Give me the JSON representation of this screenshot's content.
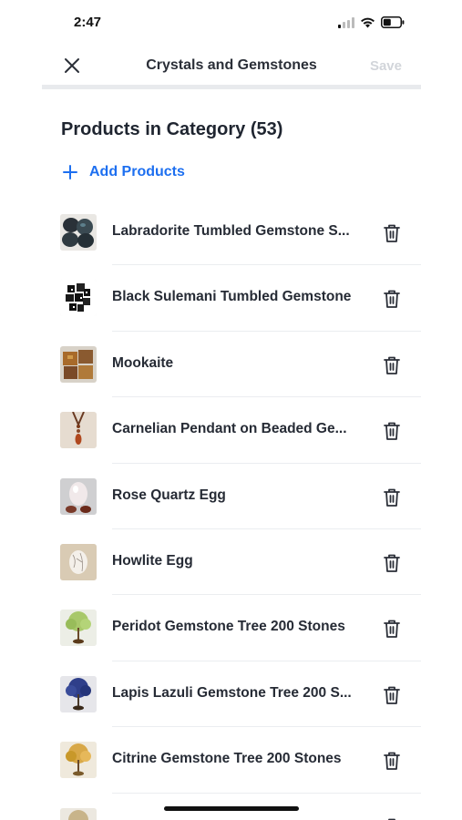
{
  "status_bar": {
    "time": "2:47"
  },
  "header": {
    "title": "Crystals and Gemstones",
    "save_label": "Save"
  },
  "section": {
    "title": "Products in Category (53)",
    "add_label": "Add Products"
  },
  "products": [
    {
      "name": "Labradorite Tumbled Gemstone S...",
      "thumb": "labradorite"
    },
    {
      "name": "Black Sulemani Tumbled Gemstone",
      "thumb": "sulemani"
    },
    {
      "name": "Mookaite",
      "thumb": "mookaite"
    },
    {
      "name": "Carnelian Pendant on Beaded Ge...",
      "thumb": "carnelian"
    },
    {
      "name": "Rose Quartz Egg",
      "thumb": "rose-quartz"
    },
    {
      "name": "Howlite Egg",
      "thumb": "howlite"
    },
    {
      "name": "Peridot Gemstone Tree 200 Stones",
      "thumb": "peridot-tree"
    },
    {
      "name": "Lapis Lazuli Gemstone Tree 200 S...",
      "thumb": "lapis-tree"
    },
    {
      "name": "Citrine Gemstone Tree 200 Stones",
      "thumb": "citrine-tree"
    },
    {
      "name": "",
      "thumb": "partial"
    }
  ],
  "colors": {
    "accent": "#1d6ff0",
    "save_disabled": "#d2d5da",
    "text": "#1f2530"
  }
}
